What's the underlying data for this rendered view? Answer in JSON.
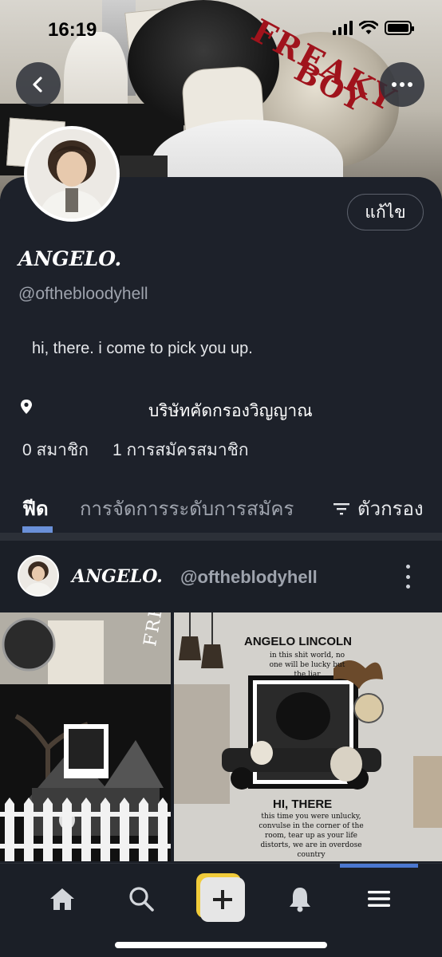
{
  "status_bar": {
    "time": "16:19"
  },
  "cover": {
    "overlay_text_line1": "FREAKY",
    "overlay_text_line2": "BOY"
  },
  "header": {
    "back_icon": "chevron-left-icon",
    "more_icon": "more-horizontal-icon"
  },
  "profile": {
    "edit_label": "แก้ไข",
    "display_name": "ANGELO.",
    "handle": "@ofthebloodyhell",
    "bio": "hi, there. i come to pick you up.",
    "location": "บริษัทคัดกรองวิญญาณ",
    "members": "0 สมาชิก",
    "subscriptions": "1 การสมัครสมาชิก"
  },
  "tabs": {
    "feed": "ฟีด",
    "manage": "การจัดการระดับการสมัคร",
    "filter": "ตัวกรอง"
  },
  "post": {
    "author": "ANGELO.",
    "handle": "@oftheblodyhell",
    "image_left_text": "FREAKY",
    "image_right": {
      "title": "ANGELO LINCOLN",
      "subtitle": "in this shit world, no one will be lucky but the liar",
      "heading": "HI, THERE",
      "body": "this time you were unlucky, convulse in the corner of the room, tear up as your life distorts, we are in overdose country"
    }
  },
  "bottom_nav": {
    "items": [
      "home-icon",
      "search-icon",
      "add-icon",
      "bell-icon",
      "menu-icon"
    ],
    "active": "menu-icon"
  },
  "colors": {
    "background": "#1b1f27",
    "accent": "#4b77cf",
    "plus_accent": "#f1cb3a"
  }
}
